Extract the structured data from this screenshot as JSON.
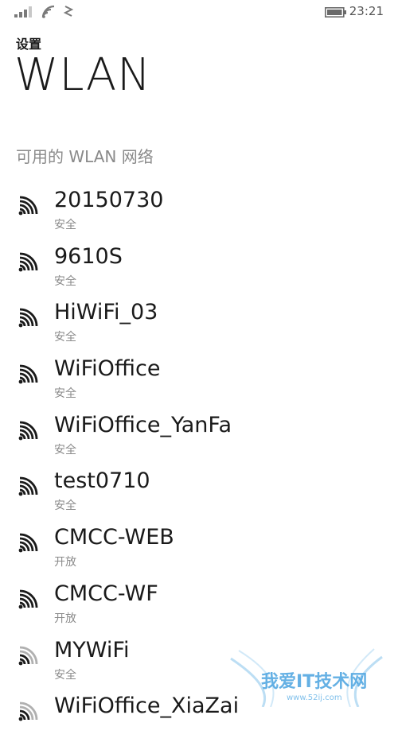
{
  "status_bar": {
    "time": "23:21",
    "icons": [
      "signal-strength-icon",
      "wifi-icon",
      "data-icon",
      "battery-icon"
    ]
  },
  "header": {
    "breadcrumb": "设置",
    "title": "WLAN"
  },
  "section": {
    "title": "可用的 WLAN 网络"
  },
  "networks": [
    {
      "name": "20150730",
      "status": "安全",
      "signal": 4
    },
    {
      "name": "9610S",
      "status": "安全",
      "signal": 4
    },
    {
      "name": "HiWiFi_03",
      "status": "安全",
      "signal": 4
    },
    {
      "name": "WiFiOffice",
      "status": "安全",
      "signal": 4
    },
    {
      "name": "WiFiOffice_YanFa",
      "status": "安全",
      "signal": 4
    },
    {
      "name": "test0710",
      "status": "安全",
      "signal": 4
    },
    {
      "name": "CMCC-WEB",
      "status": "开放",
      "signal": 4
    },
    {
      "name": "CMCC-WF",
      "status": "开放",
      "signal": 4
    },
    {
      "name": "MYWiFi",
      "status": "安全",
      "signal": 2
    },
    {
      "name": "WiFiOffice_XiaZai",
      "status": "",
      "signal": 2
    }
  ],
  "watermark": {
    "text": "我爱IT技术网",
    "subtext": "www.52ij.com"
  },
  "colors": {
    "text_primary": "#1a1a1a",
    "text_secondary": "#8a8a8a",
    "icon_dim": "#b0b0b0",
    "watermark_blue": "#4aa3e0"
  }
}
